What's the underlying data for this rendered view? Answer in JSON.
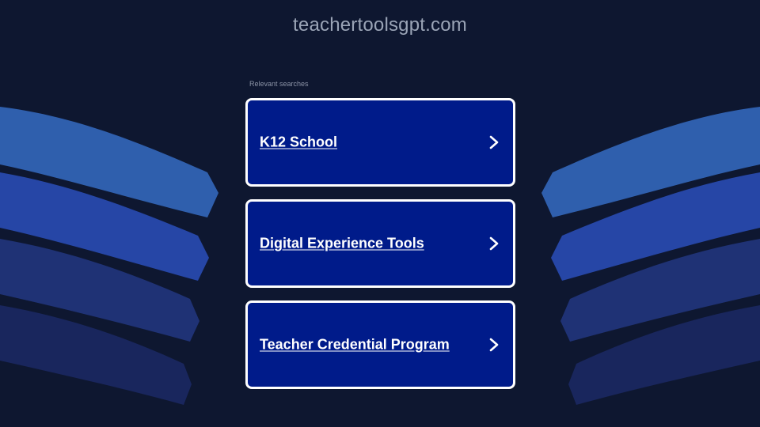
{
  "page": {
    "domain": "teachertoolsgpt.com",
    "related_label": "Relevant searches"
  },
  "results": [
    {
      "label": "K12 School",
      "icon": "chevron-right-icon"
    },
    {
      "label": "Digital Experience Tools",
      "icon": "chevron-right-icon"
    },
    {
      "label": "Teacher Credential Program",
      "icon": "chevron-right-icon"
    }
  ],
  "colors": {
    "background": "#0e1730",
    "card_fill": "#001b8a",
    "card_border": "#ffffff",
    "wave_1": "#2f5fad",
    "wave_2": "#2646a6",
    "wave_3": "#1f3275",
    "wave_4": "#19265d"
  }
}
